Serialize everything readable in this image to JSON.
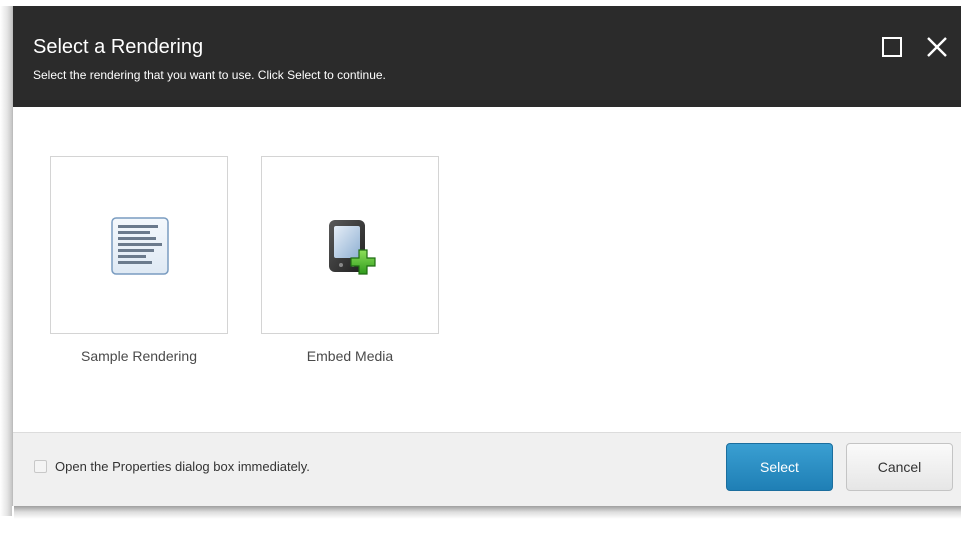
{
  "dialog": {
    "title": "Select a Rendering",
    "subtitle": "Select the rendering that you want to use. Click Select to continue.",
    "header_icons": [
      "maximize-icon",
      "close-icon"
    ]
  },
  "renderings": [
    {
      "label": "Sample Rendering",
      "icon": "document-lines-icon"
    },
    {
      "label": "Embed Media",
      "icon": "device-add-icon"
    }
  ],
  "footer": {
    "checkbox_label": "Open the Properties dialog box immediately.",
    "checkbox_checked": false,
    "select_label": "Select",
    "cancel_label": "Cancel"
  },
  "colors": {
    "header_bg": "#2b2b2b",
    "primary_button": "#2a8cc4",
    "footer_bg": "#f0f0f0"
  }
}
